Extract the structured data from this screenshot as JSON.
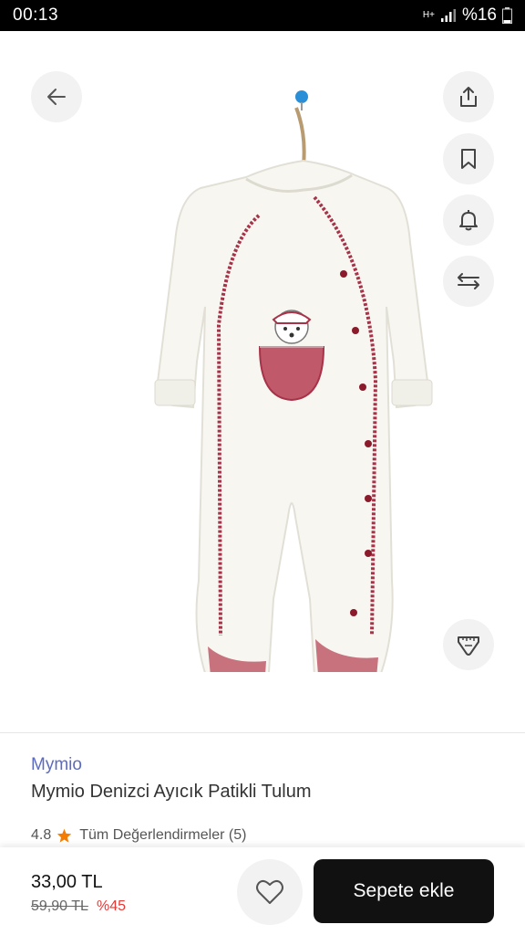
{
  "status_bar": {
    "time": "00:13",
    "network": "H+",
    "battery": "%16"
  },
  "toolbar": {
    "back_icon": "arrow-left-icon",
    "share_icon": "share-icon",
    "bookmark_icon": "bookmark-icon",
    "bell_icon": "bell-icon",
    "compare_icon": "compare-arrows-icon",
    "size_icon": "ruler-icon"
  },
  "product": {
    "brand": "Mymio",
    "title": "Mymio Denizci Ayıcık Patikli Tulum",
    "rating": "4.8",
    "reviews_link": "Tüm Değerlendirmeler (5)"
  },
  "purchase": {
    "price": "33,00 TL",
    "old_price": "59,90 TL",
    "discount": "%45",
    "add_to_cart": "Sepete ekle"
  },
  "colors": {
    "brand": "#5c6bc0",
    "discount": "#e53935",
    "button": "#111111",
    "star": "#f57c00"
  }
}
